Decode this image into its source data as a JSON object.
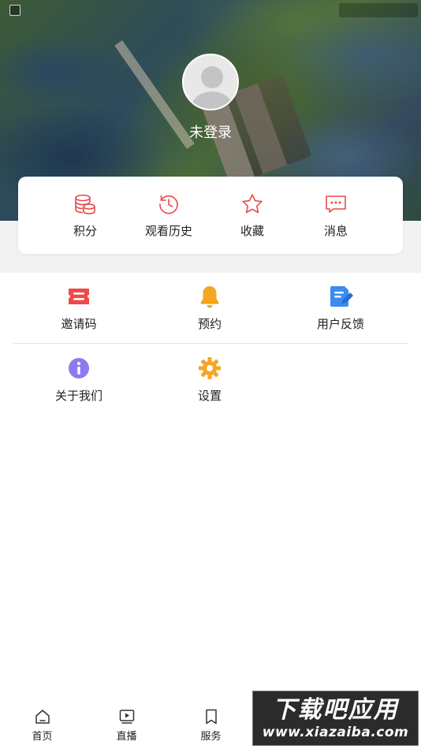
{
  "profile": {
    "login_status": "未登录"
  },
  "quick_actions": [
    {
      "icon": "coins-icon",
      "label": "积分"
    },
    {
      "icon": "history-icon",
      "label": "观看历史"
    },
    {
      "icon": "star-icon",
      "label": "收藏"
    },
    {
      "icon": "message-icon",
      "label": "消息"
    }
  ],
  "menu_items": [
    {
      "icon": "ticket-icon",
      "label": "邀请码",
      "color": "#f04040"
    },
    {
      "icon": "bell-icon",
      "label": "预约",
      "color": "#f5a623"
    },
    {
      "icon": "feedback-icon",
      "label": "用户反馈",
      "color": "#3c8cf0"
    },
    {
      "icon": "info-icon",
      "label": "关于我们",
      "color": "#8a7cf0"
    },
    {
      "icon": "settings-icon",
      "label": "设置",
      "color": "#f5a623"
    }
  ],
  "tabbar": [
    {
      "icon": "home-icon",
      "label": "首页"
    },
    {
      "icon": "live-icon",
      "label": "直播"
    },
    {
      "icon": "bookmark-icon",
      "label": "服务"
    }
  ],
  "watermark": {
    "title": "下载吧应用",
    "url": "www.xiazaiba.com"
  },
  "colors": {
    "accent_red": "#e84a4a",
    "background_gray": "#f2f2f2"
  }
}
